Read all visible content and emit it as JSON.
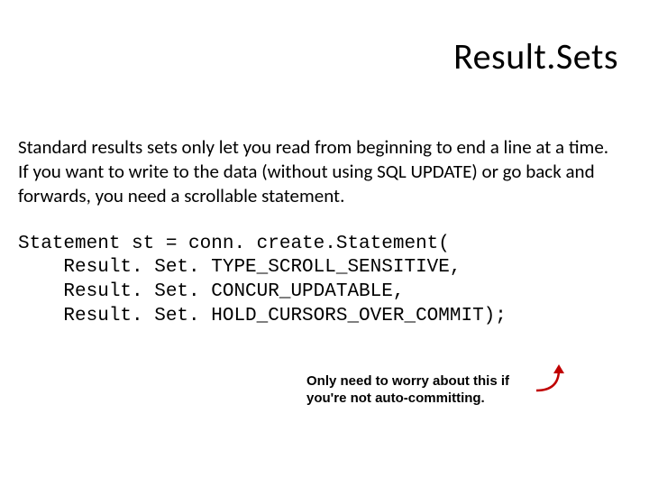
{
  "title": "Result.Sets",
  "body_para1": "Standard results sets only let you read from beginning to end a line at a time.",
  "body_para2": "If you want to write to the data (without using SQL UPDATE) or go back and forwards, you need a scrollable statement.",
  "code_l1": "Statement st = conn. create.Statement(",
  "code_l2": "    Result. Set. TYPE_SCROLL_SENSITIVE,",
  "code_l3": "    Result. Set. CONCUR_UPDATABLE,",
  "code_l4": "    Result. Set. HOLD_CURSORS_OVER_COMMIT);",
  "note": "Only need to worry about this if you're not auto-committing.",
  "arrow_color": "#c00000"
}
